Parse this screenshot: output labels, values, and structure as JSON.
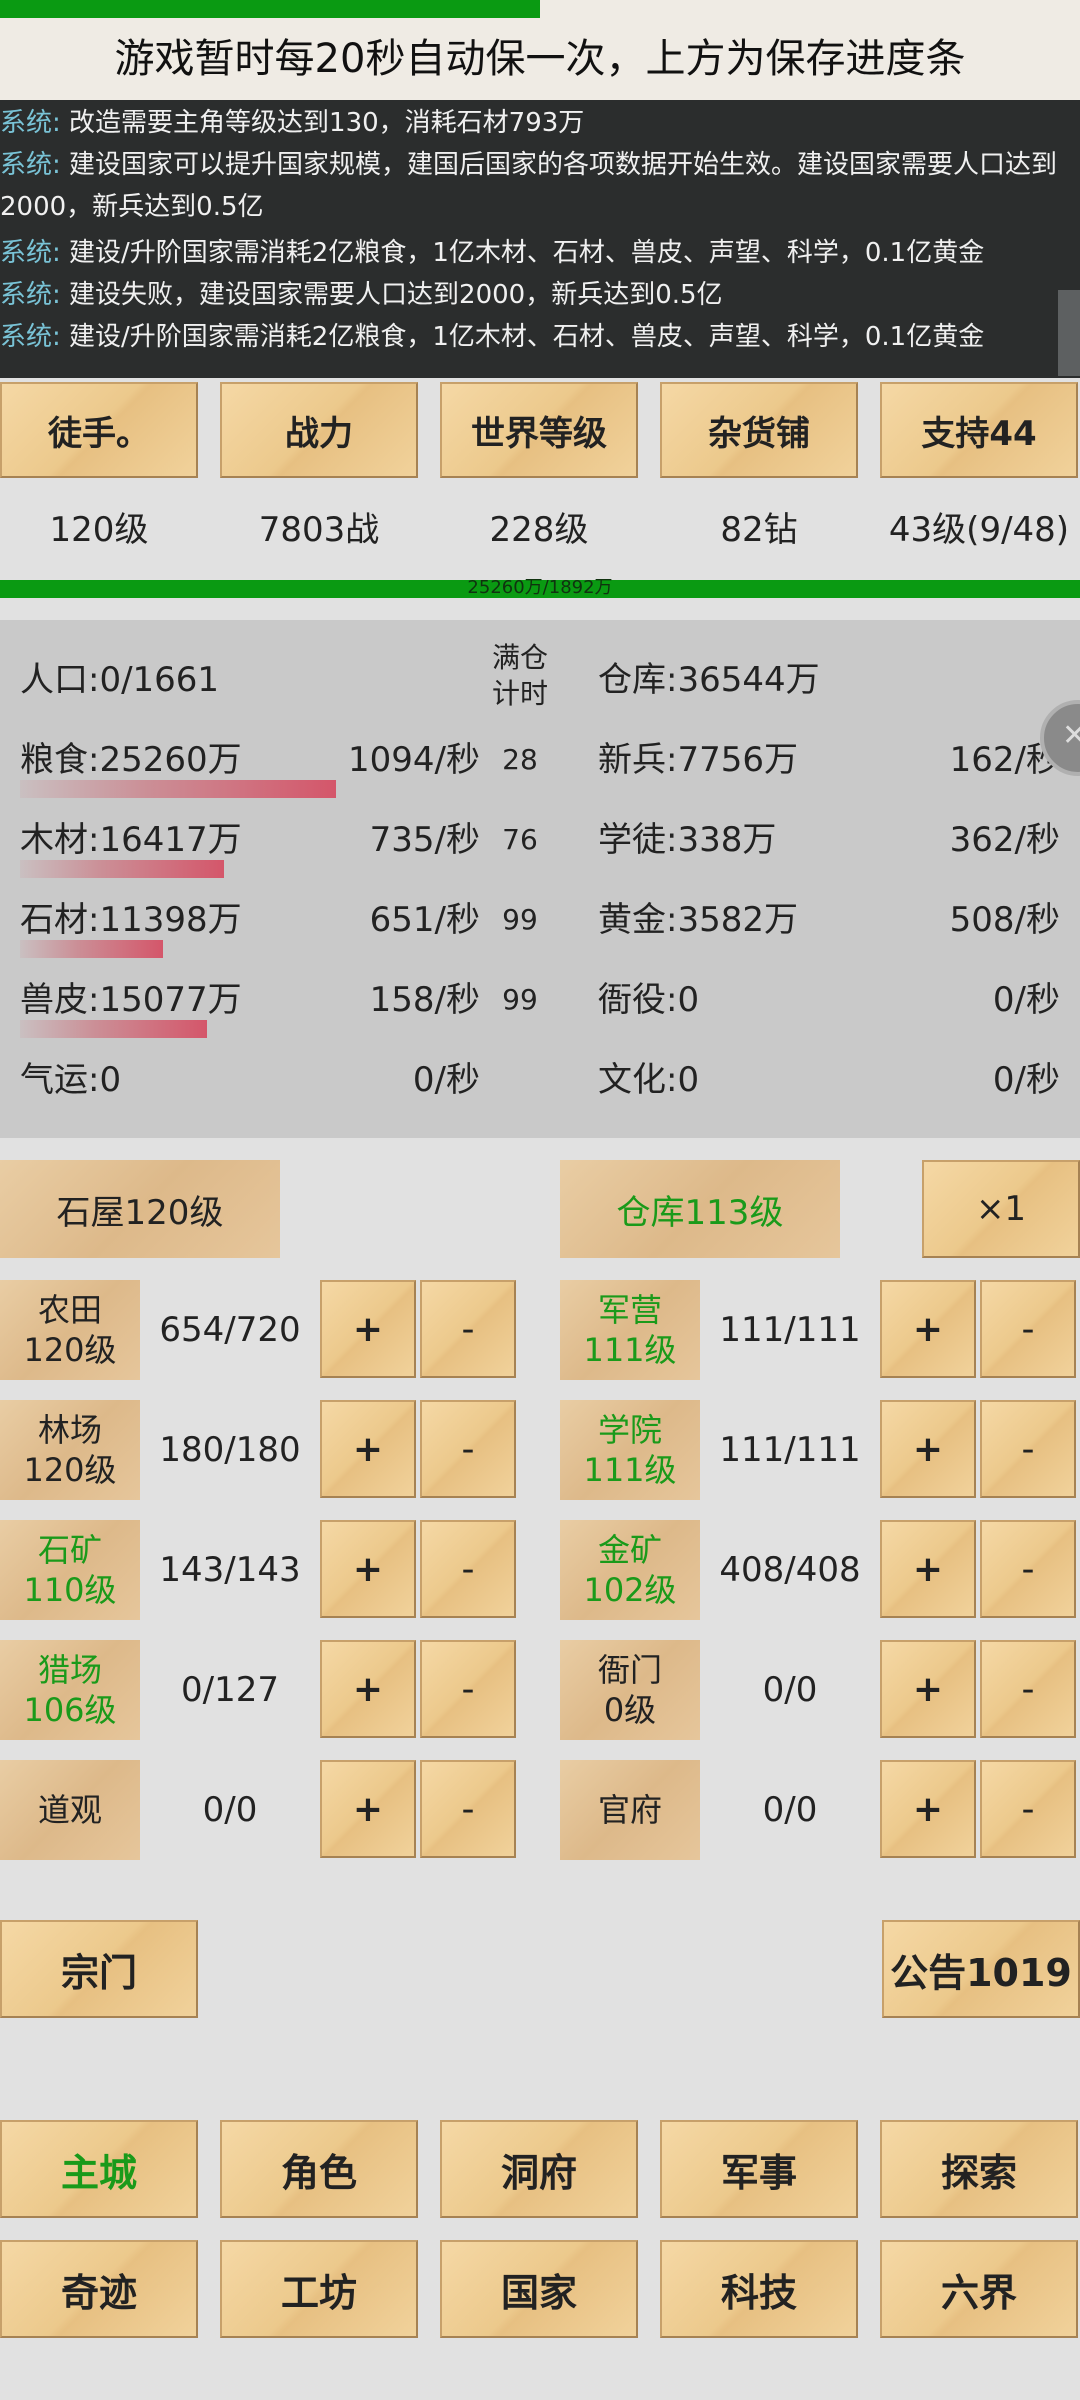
{
  "save_bar": {
    "progress": 0.5,
    "text": "游戏暂时每20秒自动保一次，上方为保存进度条"
  },
  "log": [
    {
      "prefix": "系统:",
      "text": " 改造需要主角等级达到130，消耗石材793万"
    },
    {
      "prefix": "系统:",
      "text": " 建设国家可以提升国家规模，建国后国家的各项数据开始生效。建设国家需要人口达到2000，新兵达到0.5亿"
    },
    {
      "prefix": "系统:",
      "text": " 建设/升阶国家需消耗2亿粮食，1亿木材、石材、兽皮、声望、科学，0.1亿黄金"
    },
    {
      "prefix": "系统:",
      "text": " 建设失败，建设国家需要人口达到2000，新兵达到0.5亿"
    },
    {
      "prefix": "系统:",
      "text": " 建设/升阶国家需消耗2亿粮食，1亿木材、石材、兽皮、声望、科学，0.1亿黄金"
    }
  ],
  "tabs": [
    {
      "label": "徒手。",
      "value": "120级"
    },
    {
      "label": "战力",
      "value": "7803战"
    },
    {
      "label": "世界等级",
      "value": "228级"
    },
    {
      "label": "杂货铺",
      "value": "82钻"
    },
    {
      "label": "支持44",
      "value": "43级(9/48)"
    }
  ],
  "progress": {
    "text": "25260万/1892万",
    "fraction": 1.0
  },
  "resources": {
    "mancang_label": "满仓\n计时",
    "population": "人口:0/1661",
    "warehouse": "仓库:36544万",
    "left": [
      {
        "name": "粮食:25260万",
        "rate": "1094/秒",
        "timer": "28",
        "fill": 0.93
      },
      {
        "name": "木材:16417万",
        "rate": "735/秒",
        "timer": "76",
        "fill": 0.6
      },
      {
        "name": "石材:11398万",
        "rate": "651/秒",
        "timer": "99",
        "fill": 0.42
      },
      {
        "name": "兽皮:15077万",
        "rate": "158/秒",
        "timer": "99",
        "fill": 0.55
      },
      {
        "name": "气运:0",
        "rate": "0/秒",
        "timer": "",
        "fill": 0
      }
    ],
    "right": [
      {
        "name": "新兵:7756万",
        "rate": "162/秒"
      },
      {
        "name": "学徒:338万",
        "rate": "362/秒"
      },
      {
        "name": "黄金:3582万",
        "rate": "508/秒"
      },
      {
        "name": "衙役:0",
        "rate": "0/秒"
      },
      {
        "name": "文化:0",
        "rate": "0/秒"
      }
    ]
  },
  "upgrades": {
    "house": "石屋120级",
    "warehouse": "仓库113级",
    "multiplier": "×1"
  },
  "buildings_left": [
    {
      "name": "农田",
      "level": "120级",
      "count": "654/720",
      "green": false
    },
    {
      "name": "林场",
      "level": "120级",
      "count": "180/180",
      "green": false
    },
    {
      "name": "石矿",
      "level": "110级",
      "count": "143/143",
      "green": true
    },
    {
      "name": "猎场",
      "level": "106级",
      "count": "0/127",
      "green": true
    },
    {
      "name": "道观",
      "level": "",
      "count": "0/0",
      "green": false
    }
  ],
  "buildings_right": [
    {
      "name": "军营",
      "level": "111级",
      "count": "111/111",
      "green": true
    },
    {
      "name": "学院",
      "level": "111级",
      "count": "111/111",
      "green": true
    },
    {
      "name": "金矿",
      "level": "102级",
      "count": "408/408",
      "green": true
    },
    {
      "name": "衙门",
      "level": "0级",
      "count": "0/0",
      "green": false
    },
    {
      "name": "官府",
      "level": "",
      "count": "0/0",
      "green": false
    }
  ],
  "pm": {
    "plus": "+",
    "minus": "-"
  },
  "sect_button": "宗门",
  "notice_button": "公告1019",
  "nav_row1": [
    {
      "label": "主城",
      "active": true
    },
    {
      "label": "角色",
      "active": false
    },
    {
      "label": "洞府",
      "active": false
    },
    {
      "label": "军事",
      "active": false
    },
    {
      "label": "探索",
      "active": false
    }
  ],
  "nav_row2": [
    {
      "label": "奇迹",
      "active": false
    },
    {
      "label": "工坊",
      "active": false
    },
    {
      "label": "国家",
      "active": false
    },
    {
      "label": "科技",
      "active": false
    },
    {
      "label": "六界",
      "active": false
    }
  ],
  "colors": {
    "green_bar": "#0a9a12",
    "active_text": "#1a9a1a",
    "log_prefix": "#79c3d6"
  }
}
